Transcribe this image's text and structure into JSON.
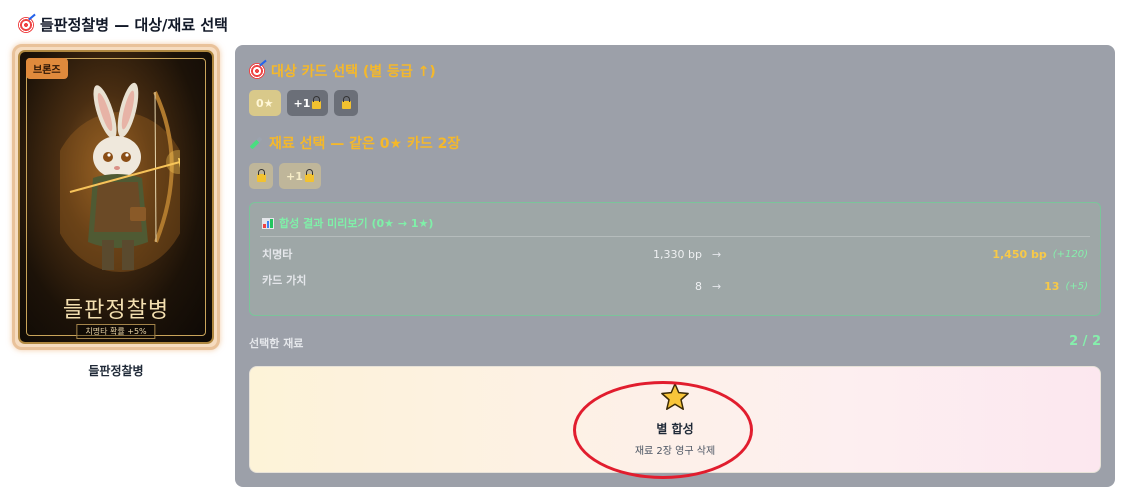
{
  "header": {
    "title": "들판정찰병 — 대상/재료 선택"
  },
  "card": {
    "rarity": "브론즈",
    "art_name": "들판정찰병",
    "art_sub": "치명타 확률 +5%",
    "caption": "들판정찰병"
  },
  "target_section": {
    "title": "대상 카드 선택 (별 등급 ↑)",
    "chips": [
      {
        "label": "0★",
        "state": "selected"
      },
      {
        "label": "+1",
        "state": "locked"
      },
      {
        "label": "",
        "state": "locked"
      }
    ]
  },
  "material_section": {
    "title": "재료 선택 — 같은 0★ 카드 2장",
    "chips": [
      {
        "label": "",
        "state": "locked"
      },
      {
        "label": "+1",
        "state": "locked"
      }
    ]
  },
  "preview": {
    "title": "합성 결과 미리보기 (0★ → 1★)",
    "rows": [
      {
        "label": "치명타",
        "old": "1,330 bp",
        "arrow": "→",
        "new": "1,450 bp",
        "delta": "(+120)"
      },
      {
        "label": "카드 가치",
        "old": "8",
        "arrow": "→",
        "new": "13",
        "delta": "(+5)"
      }
    ]
  },
  "selected": {
    "label": "선택한 재료",
    "count": "2 / 2"
  },
  "synth": {
    "label": "별 합성",
    "sub": "재료 2장 영구 삭제"
  },
  "colors": {
    "accent_gold": "#f5b82a",
    "accent_green": "#86efac",
    "panel": "#9ca0a9",
    "highlight_red": "#e11d2e"
  }
}
